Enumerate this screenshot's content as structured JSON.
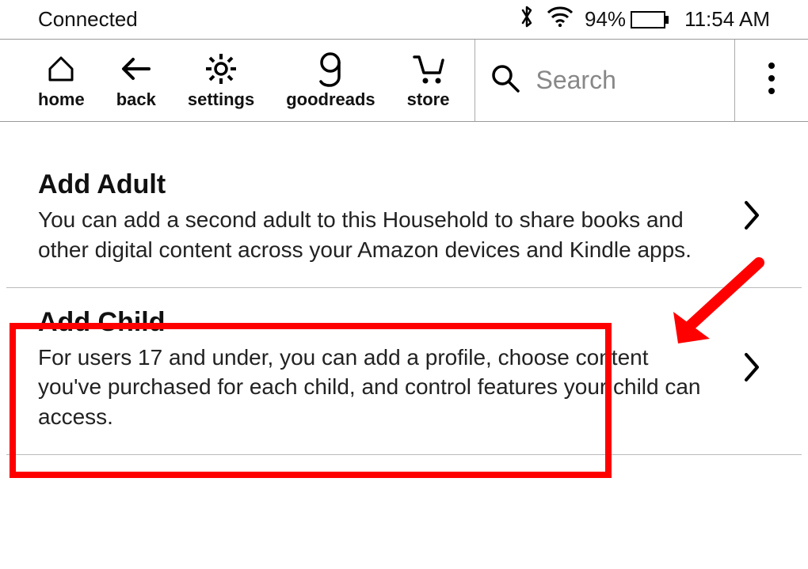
{
  "status": {
    "connection": "Connected",
    "battery_percent": "94%",
    "battery_fill_pct": 94,
    "time": "11:54 AM"
  },
  "toolbar": {
    "home": "home",
    "back": "back",
    "settings": "settings",
    "goodreads": "goodreads",
    "store": "store"
  },
  "search": {
    "placeholder": "Search"
  },
  "items": [
    {
      "title": "Add Adult",
      "desc": "You can add a second adult to this Household to share books and other digital content across your Amazon devices and Kindle apps."
    },
    {
      "title": "Add Child",
      "desc": "For users 17 and under, you can add a profile, choose content you've purchased for each child, and control features your child can access."
    }
  ],
  "highlight_color": "#ff0000"
}
